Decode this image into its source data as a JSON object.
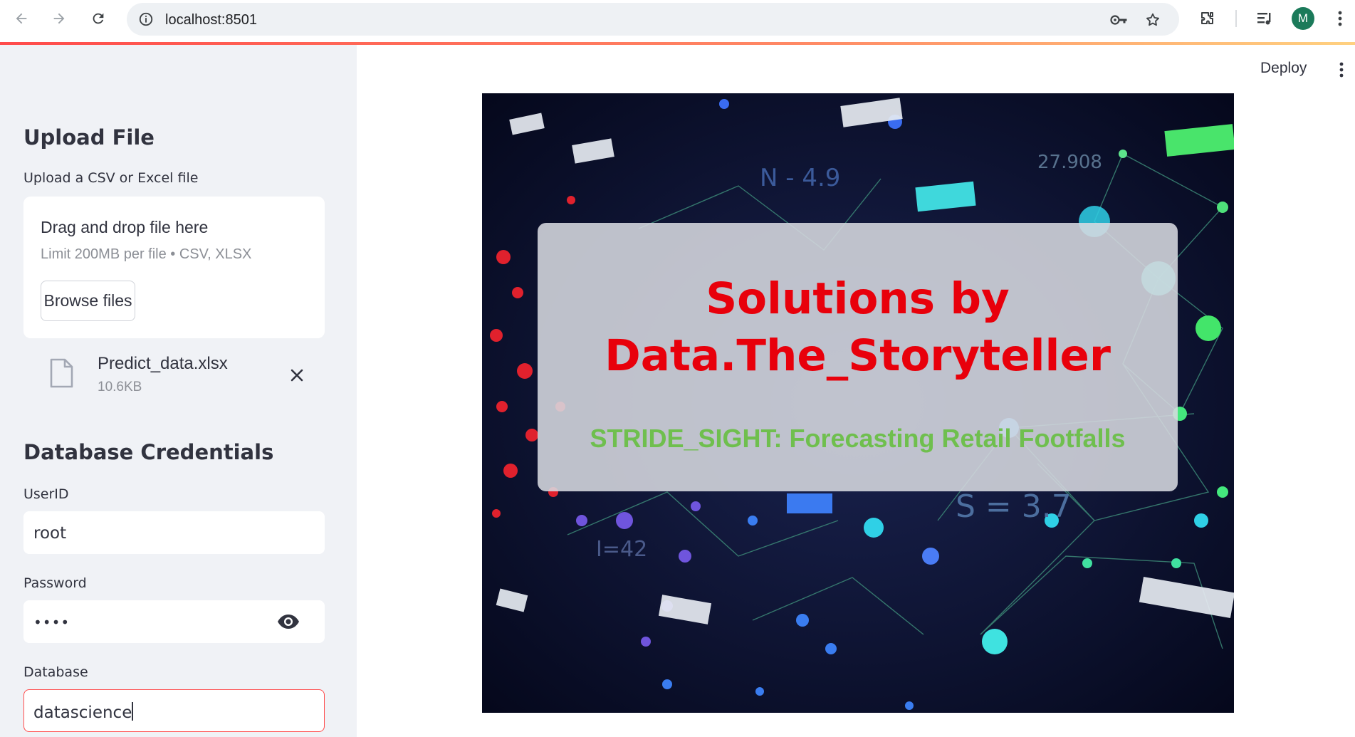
{
  "browser": {
    "url": "localhost:8501",
    "profile_initial": "M",
    "icons": [
      "back-icon",
      "forward-icon",
      "reload-icon",
      "info-icon",
      "key-icon",
      "star-icon",
      "extensions-icon",
      "media-icon",
      "menu-icon"
    ]
  },
  "sidebar": {
    "upload_heading": "Upload File",
    "upload_label": "Upload a CSV or Excel file",
    "dropzone_title": "Drag and drop file here",
    "dropzone_limit": "Limit 200MB per file • CSV, XLSX",
    "browse_label": "Browse files",
    "file_name": "Predict_data.xlsx",
    "file_size": "10.6KB",
    "db_heading": "Database Credentials",
    "userid_label": "UserID",
    "userid_value": "root",
    "password_label": "Password",
    "password_value": "••••",
    "database_label": "Database",
    "database_value": "datascience"
  },
  "main": {
    "deploy_label": "Deploy",
    "hero_title_line1": "Solutions by",
    "hero_title_line2": "Data.The_Storyteller",
    "hero_subtitle": "STRIDE_SIGHT: Forecasting Retail Footfalls"
  },
  "colors": {
    "accent": "#ff4b4b",
    "title_red": "#e8000b",
    "subtitle_green": "#6fbf4e",
    "sidebar_bg": "#f0f2f6"
  }
}
